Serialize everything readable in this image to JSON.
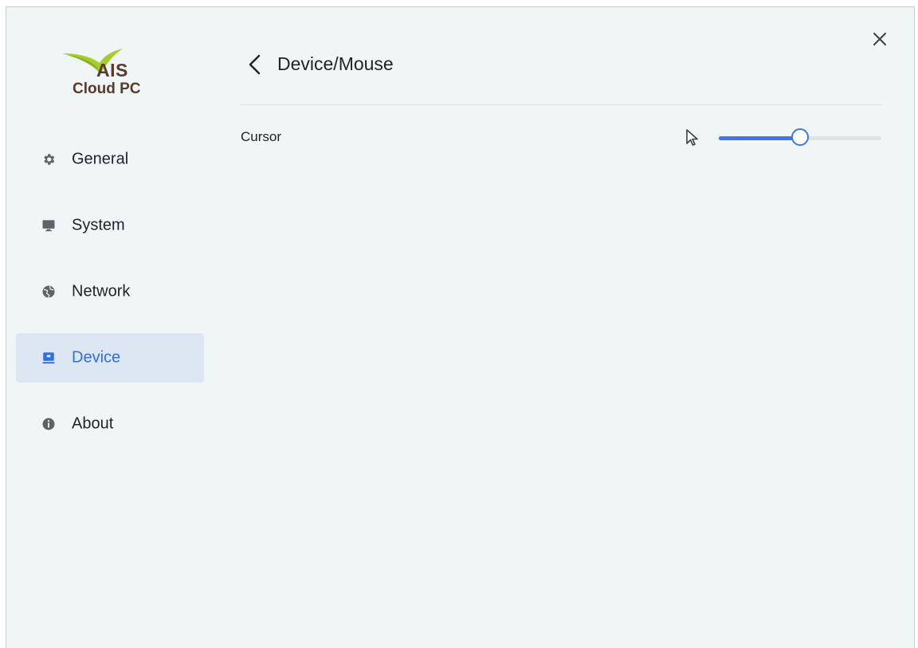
{
  "logo": {
    "brand": "AIS",
    "product": "Cloud PC"
  },
  "sidebar": {
    "items": [
      {
        "label": "General",
        "icon": "gear-icon",
        "active": false
      },
      {
        "label": "System",
        "icon": "monitor-icon",
        "active": false
      },
      {
        "label": "Network",
        "icon": "globe-icon",
        "active": false
      },
      {
        "label": "Device",
        "icon": "device-icon",
        "active": true
      },
      {
        "label": "About",
        "icon": "info-icon",
        "active": false
      }
    ]
  },
  "header": {
    "title": "Device/Mouse",
    "back_icon": "chevron-left-icon",
    "close_icon": "close-icon"
  },
  "settings": {
    "cursor": {
      "label": "Cursor",
      "icon": "cursor-arrow-icon",
      "value_fraction": 0.5
    }
  },
  "colors": {
    "accent": "#3a78ea",
    "active_bg": "#dde6f3",
    "window_bg": "#f0f5f6",
    "logo_text": "#5a3a2c",
    "logo_swoosh": "#9acd32"
  }
}
